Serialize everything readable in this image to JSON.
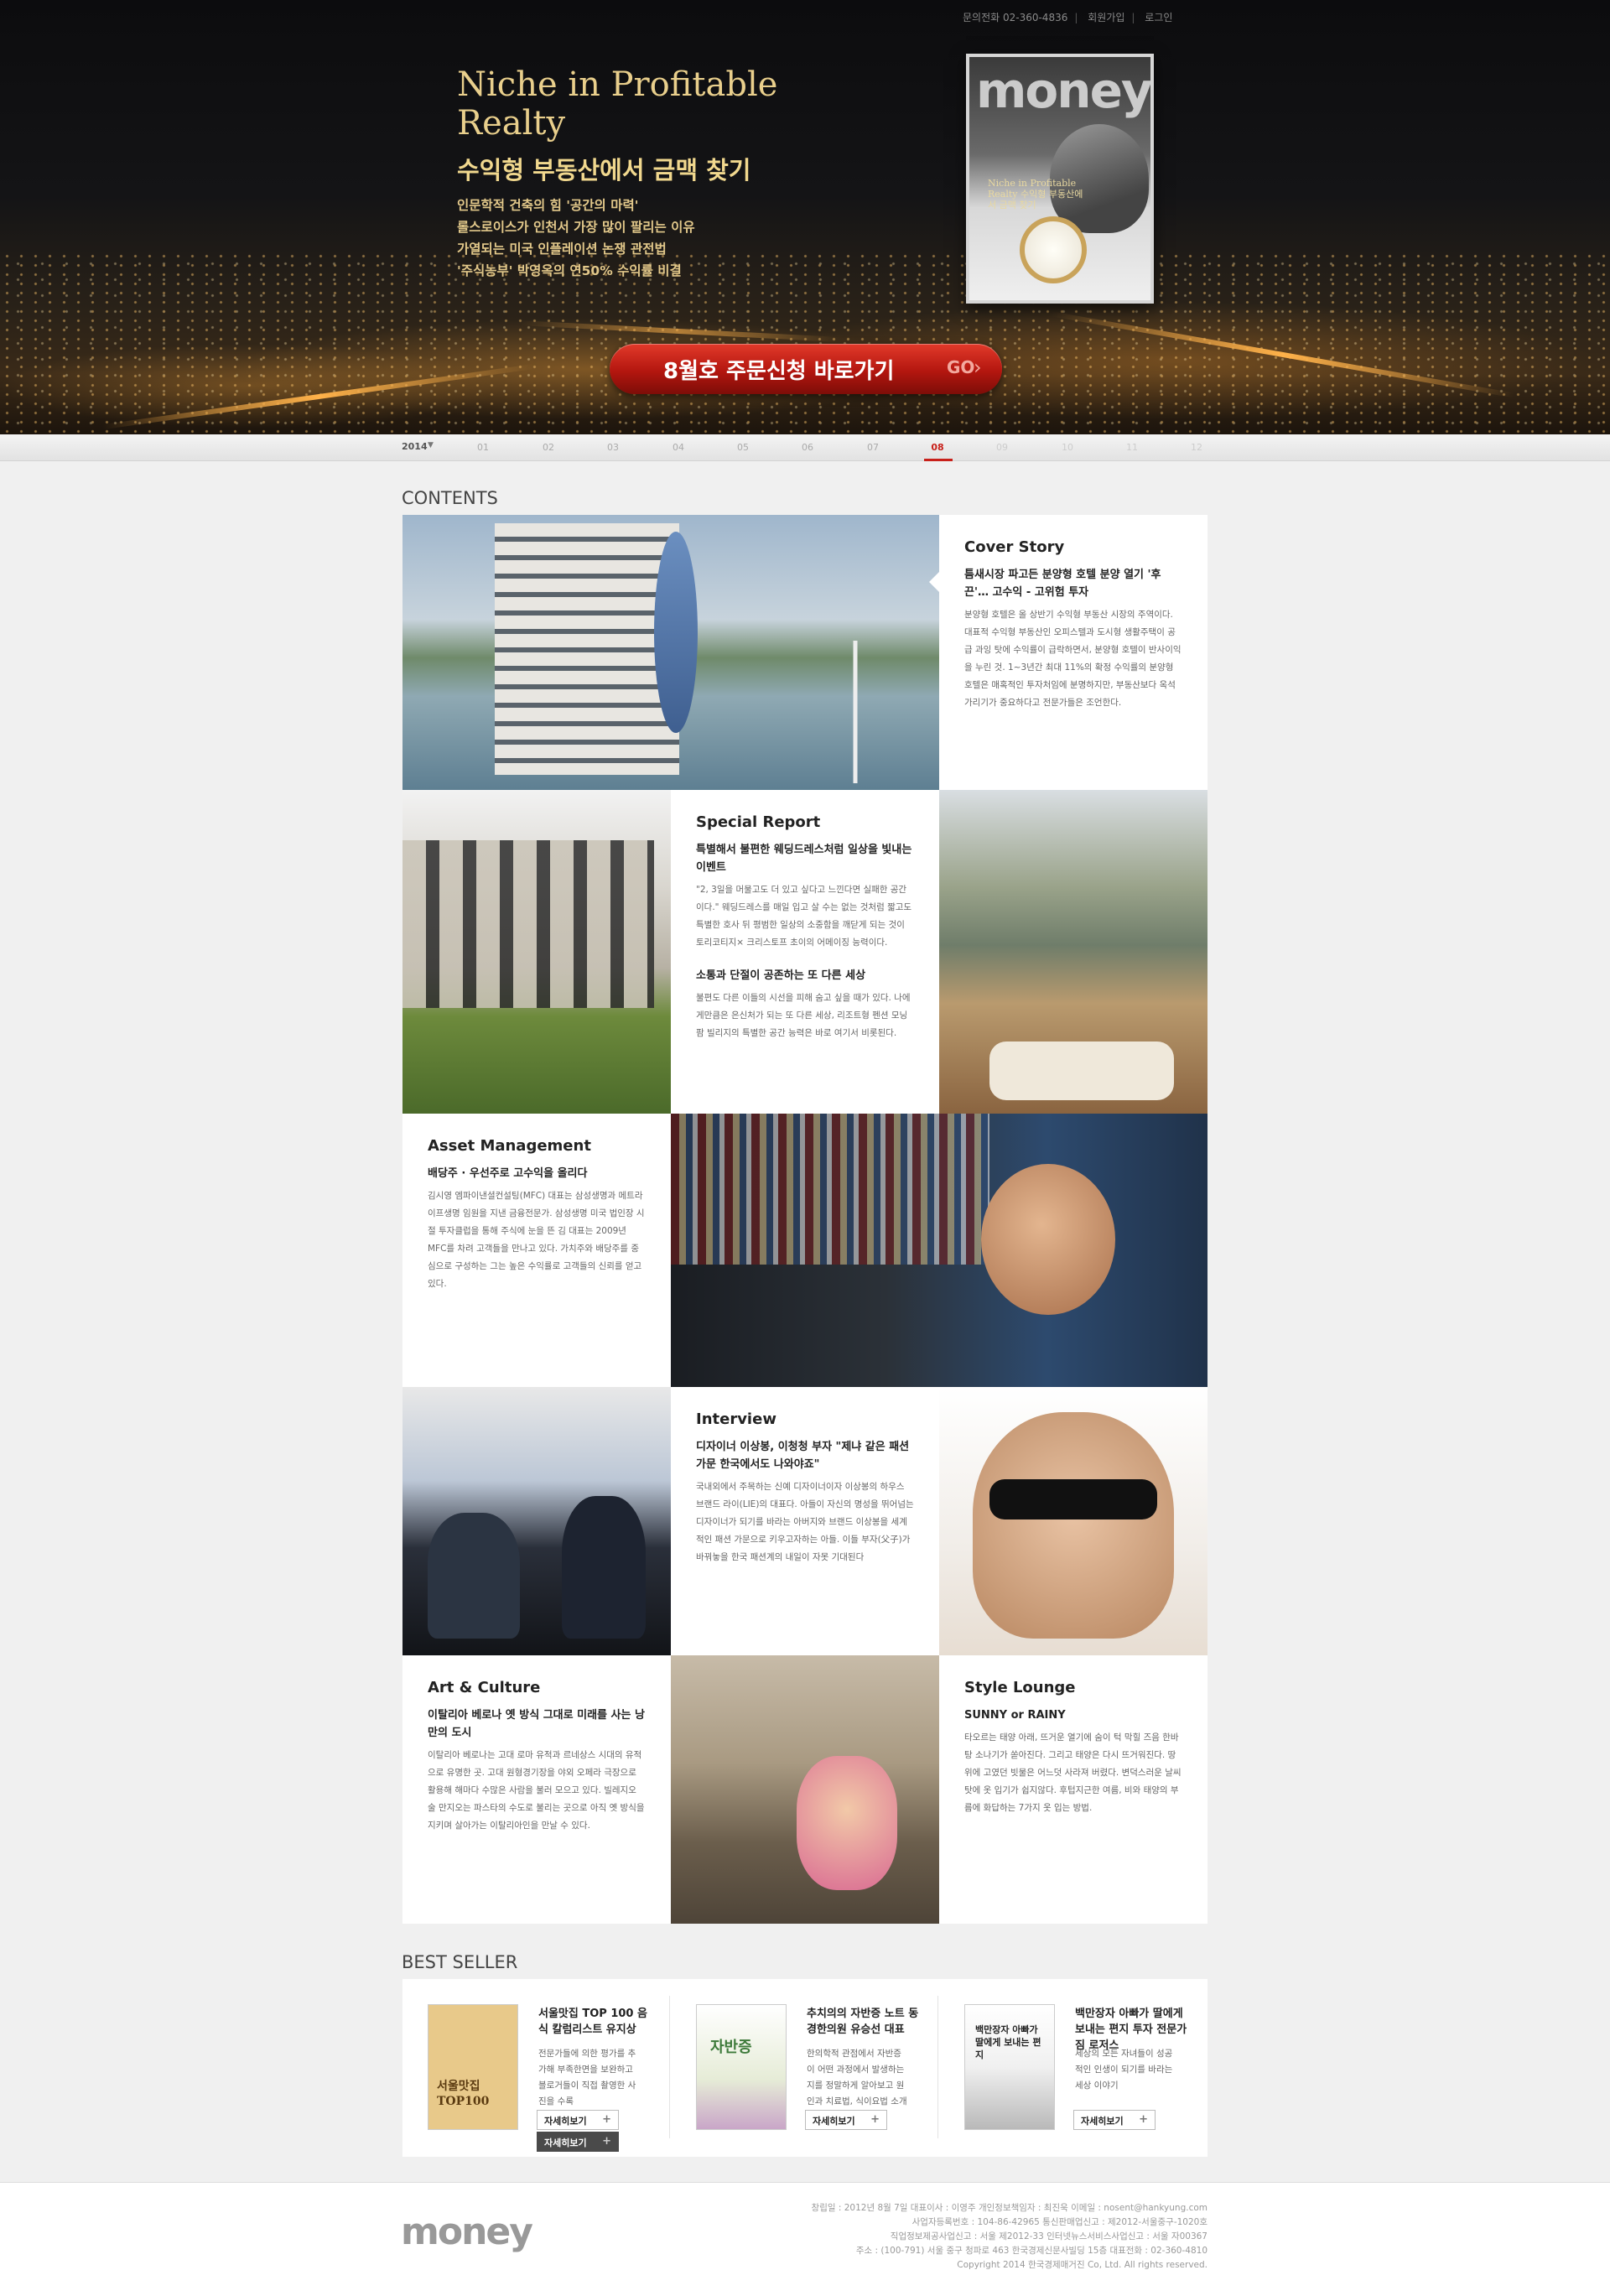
{
  "topnav": {
    "phone": "문의전화 02-360-4836",
    "join": "회원가입",
    "login": "로그인"
  },
  "hero": {
    "title": "Niche in Profitable Realty",
    "subtitle": "수익형 부동산에서 금맥 찾기",
    "points": [
      "인문학적 건축의 힘 '공간의 마력'",
      "롤스로이스가 인천서 가장 많이 팔리는 이유",
      "가열되는 미국 인플레이션 논쟁 관전법",
      "'주식농부' 박영옥의 연50% 수익률 비결"
    ],
    "cover_logo": "money",
    "cover_text": "Niche in Profitable Realty 수익형 부동산에서 금맥 찾기",
    "cta_label": "8월호 주문신청 바로가기",
    "cta_go": "GO"
  },
  "months": {
    "year": "2014",
    "items": [
      "01",
      "02",
      "03",
      "04",
      "05",
      "06",
      "07",
      "08",
      "09",
      "10",
      "11",
      "12"
    ],
    "active": "08"
  },
  "contents": {
    "heading": "CONTENTS",
    "cover_story": {
      "title": "Cover Story",
      "head": "틈새시장 파고든 분양형 호텔 분양 열기 '후끈'… 고수익 - 고위험 투자",
      "body": "분양형 호텔은 올 상반기 수익형 부동산 시장의 주역이다. 대표적 수익형 부동산인 오피스텔과 도시형 생활주택이 공급 과잉 탓에 수익률이 급락하면서, 분양형 호텔이 반사이익을 누린 것. 1~3년간 최대 11%의 확정 수익률의 분양형 호텔은 매혹적인 투자처임에 분명하지만, 부동산보다 옥석 가리기가 중요하다고 전문가들은 조언한다."
    },
    "special_report": {
      "title": "Special Report",
      "head1": "특별해서 불편한 웨딩드레스처럼 일상을 빛내는 이벤트",
      "body1": "\"2, 3일을 머물고도 더 있고 싶다고 느낀다면 실패한 공간이다.\" 웨딩드레스를 매일 입고 살 수는 없는 것처럼 짧고도 특별한 호사 뒤 평범한 일상의 소중함을 깨닫게 되는 것이 토리코티지× 크리스토프 초이의 어메이징 능력이다.",
      "head2": "소통과 단절이 공존하는 또 다른 세상",
      "body2": "불편도 다른 이들의 시선을 피해 숨고 싶을 때가 있다. 나에게만큼은 은신처가 되는 또 다른 세상, 리조트형 펜션 모닝팜 빌리지의 특별한 공간 능력은 바로 여기서 비롯된다."
    },
    "asset_management": {
      "title": "Asset Management",
      "head": "배당주 · 우선주로 고수익을 올리다",
      "body": "김시영 엠파이낸셜컨설팅(MFC) 대표는 삼성생명과 메트라이프생명 임원을 지낸 금융전문가. 삼성생명 미국 법인장 시절 투자클럽을 통해 주식에 눈을 뜬 김 대표는 2009년 MFC를 차려 고객들을 만나고 있다. 가치주와 배당주를 중심으로 구성하는 그는 높은 수익률로 고객들의 신뢰를 얻고 있다."
    },
    "interview": {
      "title": "Interview",
      "head": "디자이너 이상봉, 이청청 부자 \"제냐 같은 패션 가문 한국에서도 나와야죠\"",
      "body": "국내외에서 주목하는 신예 디자이너이자 이상봉의 하우스 브랜드 라이(LIE)의 대표다. 아들이 자신의 명성을 뛰어넘는 디자이너가 되기를 바라는 아버지와 브랜드 이상봉을 세계적인 패션 가문으로 키우고자하는 아들. 이들 부자(父子)가 바꿔놓을 한국 패션계의 내일이 자못 기대된다"
    },
    "art_culture": {
      "title": "Art & Culture",
      "head": "이탈리아 베로나 옛 방식 그대로 미래를 사는 낭만의 도시",
      "body": "이탈리아 베로나는 고대 로마 유적과 르네상스 시대의 유적으로 유명한 곳. 고대 원형경기장을 야외 오페라 극장으로 활용해 해마다 수많은 사람을 불러 모으고 있다. 빌레지오 술 만지오는 파스타의 수도로 불리는 곳으로 아직 옛 방식을 지키며 살아가는 이탈리아인을 만날 수 있다."
    },
    "style_lounge": {
      "title": "Style Lounge",
      "head": "SUNNY or RAINY",
      "body": "타오르는 태양 아래, 뜨거운 열기에 숨이 턱 막힐 즈음 한바탕 소나기가 쏟아진다. 그리고 태양은 다시 뜨거워진다. 땅 위에 고였던 빗물은 어느덧 사라져 버렸다. 변덕스러운 날씨 탓에 옷 입기가 쉽지않다. 후텁지근한 여름, 비와 태양의 부름에 화답하는 7가지 옷 입는 방법."
    }
  },
  "bestseller": {
    "heading": "BEST SELLER",
    "items": [
      {
        "title": "서울맛집 TOP 100 음식 칼럼리스트 유지상",
        "desc": "전문가들에 의한 평가를 추가해 부족한면을 보완하고 블로거들이 직접 촬영한 사진을 수록",
        "btn": "자세히보기",
        "btn2": "자세히보기",
        "cover": "서울맛집 TOP100"
      },
      {
        "title": "추치의의 자반증 노트 동경한의원 유승선 대표",
        "desc": "한의학적 관점에서 자반증이 어떤 과정에서 발생하는지를 정말하게 알아보고 원인과 치료법, 식이요법 소개",
        "btn": "자세히보기",
        "cover": "자반증"
      },
      {
        "title": "백만장자 아빠가 딸에게 보내는 편지 투자 전문가 짐 로저스",
        "desc": "세상의 모든 자녀들이 성공적인 인생이 되기를 바라는 세상 이야기",
        "btn": "자세히보기",
        "cover": "백만장자 아빠가 딸에게 보내는 편지"
      }
    ]
  },
  "footer": {
    "logo": "money",
    "lines": [
      "창립일 : 2012년 8월 7일 대표이사 : 이영주 개인정보책임자 : 최진욱 이메일 : nosent@hankyung.com",
      "사업자등록번호 : 104-86-42965 통신판매업신고 : 제2012-서울중구-1020호",
      "직업정보제공사업신고 : 서울 제2012-33 인터넷뉴스서비스사업신고 : 서울 자00367",
      "주소 : (100-791) 서울 중구 청파로 463 한국경제신문사빌딩 15층 대표전화 : 02-360-4810",
      "Copyright 2014 한국경제매거진 Co, Ltd. All rights reserved."
    ]
  },
  "colors": {
    "accent": "#c8201a",
    "hero_gold": "#e9cf8c",
    "cta_red": "#b3160f"
  }
}
